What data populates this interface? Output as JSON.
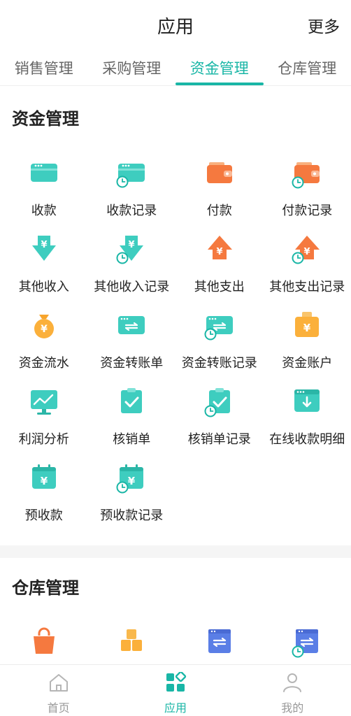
{
  "header": {
    "title": "应用",
    "more": "更多"
  },
  "tabs": [
    {
      "label": "销售管理",
      "active": false
    },
    {
      "label": "采购管理",
      "active": false
    },
    {
      "label": "资金管理",
      "active": true
    },
    {
      "label": "仓库管理",
      "active": false
    }
  ],
  "colors": {
    "accent": "#19b6a6",
    "teal": "#3ecdbf",
    "orange": "#f5793f",
    "yellow": "#fbb03b",
    "blue": "#5a7ee6"
  },
  "sections": [
    {
      "title": "资金管理",
      "items": [
        {
          "label": "收款",
          "icon": "card-icon"
        },
        {
          "label": "收款记录",
          "icon": "card-record-icon"
        },
        {
          "label": "付款",
          "icon": "wallet-icon"
        },
        {
          "label": "付款记录",
          "icon": "wallet-record-icon"
        },
        {
          "label": "其他收入",
          "icon": "arrow-down-yen-icon"
        },
        {
          "label": "其他收入记录",
          "icon": "arrow-down-yen-record-icon"
        },
        {
          "label": "其他支出",
          "icon": "arrow-up-yen-icon"
        },
        {
          "label": "其他支出记录",
          "icon": "arrow-up-yen-record-icon"
        },
        {
          "label": "资金流水",
          "icon": "money-bag-icon"
        },
        {
          "label": "资金转账单",
          "icon": "transfer-card-icon"
        },
        {
          "label": "资金转账记录",
          "icon": "transfer-card-record-icon"
        },
        {
          "label": "资金账户",
          "icon": "account-bag-icon"
        },
        {
          "label": "利润分析",
          "icon": "monitor-chart-icon"
        },
        {
          "label": "核销单",
          "icon": "clipboard-check-icon"
        },
        {
          "label": "核销单记录",
          "icon": "clipboard-check-record-icon"
        },
        {
          "label": "在线收款明细",
          "icon": "browser-download-icon"
        },
        {
          "label": "预收款",
          "icon": "calendar-yen-icon"
        },
        {
          "label": "预收款记录",
          "icon": "calendar-yen-record-icon"
        }
      ]
    },
    {
      "title": "仓库管理",
      "items": [
        {
          "label": "",
          "icon": "shopping-bag-icon"
        },
        {
          "label": "",
          "icon": "boxes-icon"
        },
        {
          "label": "",
          "icon": "transfer-doc-icon"
        },
        {
          "label": "",
          "icon": "transfer-doc-record-icon"
        }
      ]
    }
  ],
  "bottom_nav": [
    {
      "label": "首页",
      "icon": "home-icon",
      "active": false
    },
    {
      "label": "应用",
      "icon": "apps-icon",
      "active": true
    },
    {
      "label": "我的",
      "icon": "user-icon",
      "active": false
    }
  ]
}
